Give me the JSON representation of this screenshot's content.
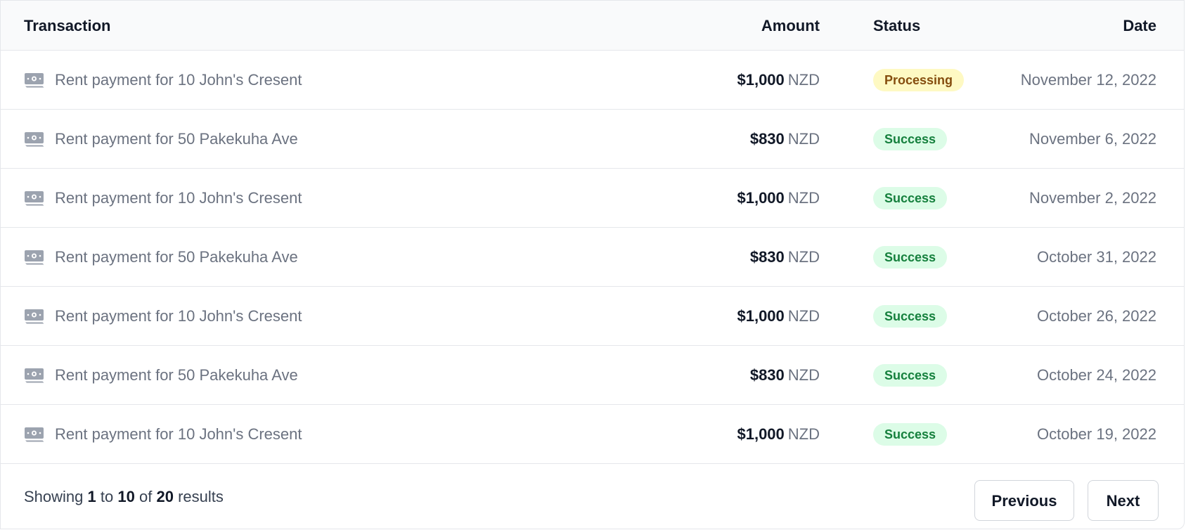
{
  "table": {
    "headers": {
      "transaction": "Transaction",
      "amount": "Amount",
      "status": "Status",
      "date": "Date"
    },
    "rows": [
      {
        "icon": "money-icon",
        "description": "Rent payment for 10 John's Cresent",
        "amount": "$1,000",
        "currency": "NZD",
        "status": "Processing",
        "status_type": "processing",
        "date": "November 12, 2022"
      },
      {
        "icon": "money-icon",
        "description": "Rent payment for 50 Pakekuha Ave",
        "amount": "$830",
        "currency": "NZD",
        "status": "Success",
        "status_type": "success",
        "date": "November 6, 2022"
      },
      {
        "icon": "money-icon",
        "description": "Rent payment for 10 John's Cresent",
        "amount": "$1,000",
        "currency": "NZD",
        "status": "Success",
        "status_type": "success",
        "date": "November 2, 2022"
      },
      {
        "icon": "money-icon",
        "description": "Rent payment for 50 Pakekuha Ave",
        "amount": "$830",
        "currency": "NZD",
        "status": "Success",
        "status_type": "success",
        "date": "October 31, 2022"
      },
      {
        "icon": "money-icon",
        "description": "Rent payment for 10 John's Cresent",
        "amount": "$1,000",
        "currency": "NZD",
        "status": "Success",
        "status_type": "success",
        "date": "October 26, 2022"
      },
      {
        "icon": "money-icon",
        "description": "Rent payment for 50 Pakekuha Ave",
        "amount": "$830",
        "currency": "NZD",
        "status": "Success",
        "status_type": "success",
        "date": "October 24, 2022"
      },
      {
        "icon": "money-icon",
        "description": "Rent payment for 10 John's Cresent",
        "amount": "$1,000",
        "currency": "NZD",
        "status": "Success",
        "status_type": "success",
        "date": "October 19, 2022"
      }
    ]
  },
  "pagination": {
    "showing_prefix": "Showing",
    "from": "1",
    "to_word": "to",
    "to": "10",
    "of_word": "of",
    "total": "20",
    "results_word": "results",
    "previous_label": "Previous",
    "next_label": "Next"
  },
  "colors": {
    "success_bg": "#dcfce7",
    "success_text": "#15803d",
    "processing_bg": "#fef9c3",
    "processing_text": "#854d0e",
    "header_bg": "#f9fafb",
    "border": "#e5e7eb",
    "muted_text": "#6b7280"
  }
}
